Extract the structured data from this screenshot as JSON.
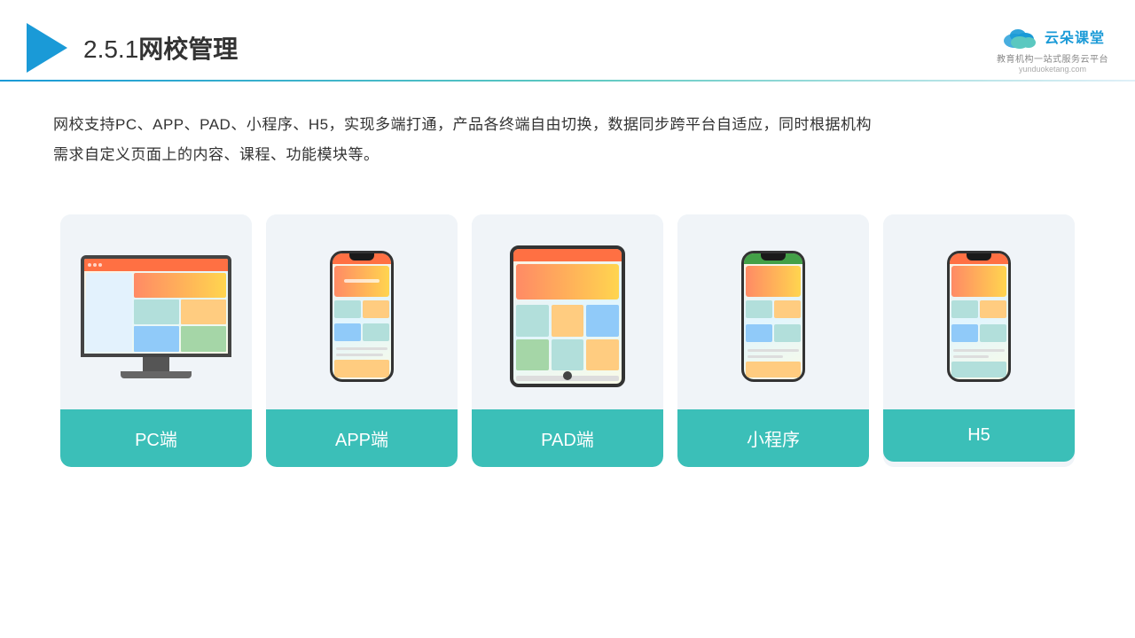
{
  "header": {
    "title_num": "2.5.1",
    "title_text": "网校管理",
    "brand_name": "云朵课堂",
    "brand_url": "yunduoketang.com",
    "brand_slogan": "教育机构一站式服务云平台"
  },
  "description": {
    "line1": "网校支持PC、APP、PAD、小程序、H5，实现多端打通，产品各终端自由切换，数据同步跨平台自适应，同时根据机构",
    "line2": "需求自定义页面上的内容、课程、功能模块等。"
  },
  "cards": [
    {
      "id": "pc",
      "label": "PC端",
      "type": "monitor"
    },
    {
      "id": "app",
      "label": "APP端",
      "type": "phone"
    },
    {
      "id": "pad",
      "label": "PAD端",
      "type": "tablet"
    },
    {
      "id": "miniprogram",
      "label": "小程序",
      "type": "wechat"
    },
    {
      "id": "h5",
      "label": "H5",
      "type": "h5"
    }
  ],
  "accent_color": "#3bbfb8"
}
